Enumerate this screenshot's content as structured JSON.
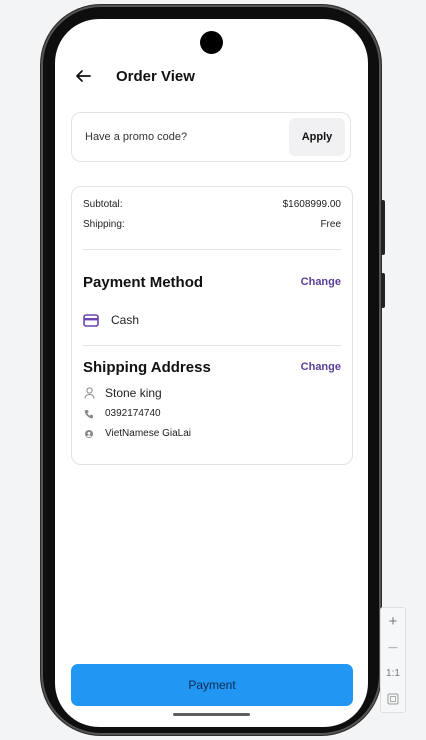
{
  "header": {
    "title": "Order View"
  },
  "promo": {
    "placeholder": "Have a promo code?",
    "apply_label": "Apply"
  },
  "summary": {
    "subtotal_label": "Subtotal:",
    "subtotal_value": "$1608999.00",
    "shipping_label": "Shipping:",
    "shipping_value": "Free"
  },
  "payment_method": {
    "title": "Payment Method",
    "change_label": "Change",
    "method": "Cash"
  },
  "shipping_address": {
    "title": "Shipping Address",
    "change_label": "Change",
    "name": "Stone king",
    "phone": "0392174740",
    "address": "VietNamese GiaLai"
  },
  "footer": {
    "payment_label": "Payment"
  },
  "zoom_controls": {
    "zoom_in": "+",
    "zoom_out": "—",
    "reset": "1:1"
  },
  "colors": {
    "accent": "#5b3e96",
    "primary_button": "#2196f3"
  },
  "icons": [
    "back-arrow-icon",
    "credit-card-icon",
    "person-icon",
    "phone-icon",
    "location-pin-icon",
    "zoom-in-icon",
    "zoom-out-icon",
    "fit-screen-icon"
  ]
}
